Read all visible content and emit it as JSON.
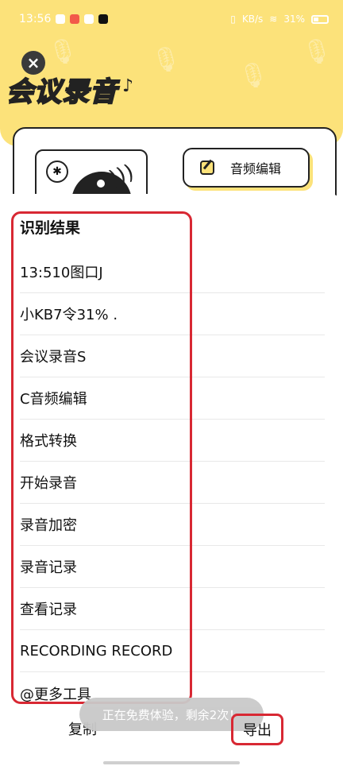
{
  "status_bar": {
    "time": "13:56",
    "battery": "31%",
    "net": "KB/s"
  },
  "header": {
    "title": "会议录音"
  },
  "card": {
    "edit_button_label": "音频编辑"
  },
  "sheet": {
    "title": "识别结果",
    "items": [
      "13:510图口J",
      "小KB7令31% .",
      "会议录音S",
      "C音频编辑",
      "格式转换",
      "开始录音",
      "录音加密",
      "录音记录",
      "查看记录",
      "RECORDING RECORD",
      "@更多工具"
    ]
  },
  "toast": {
    "text": "正在免费体验，剩余2次！"
  },
  "bottom": {
    "copy_label": "复制",
    "export_label": "导出"
  },
  "colors": {
    "accent": "#fce27a",
    "highlight_red": "#d82833"
  }
}
